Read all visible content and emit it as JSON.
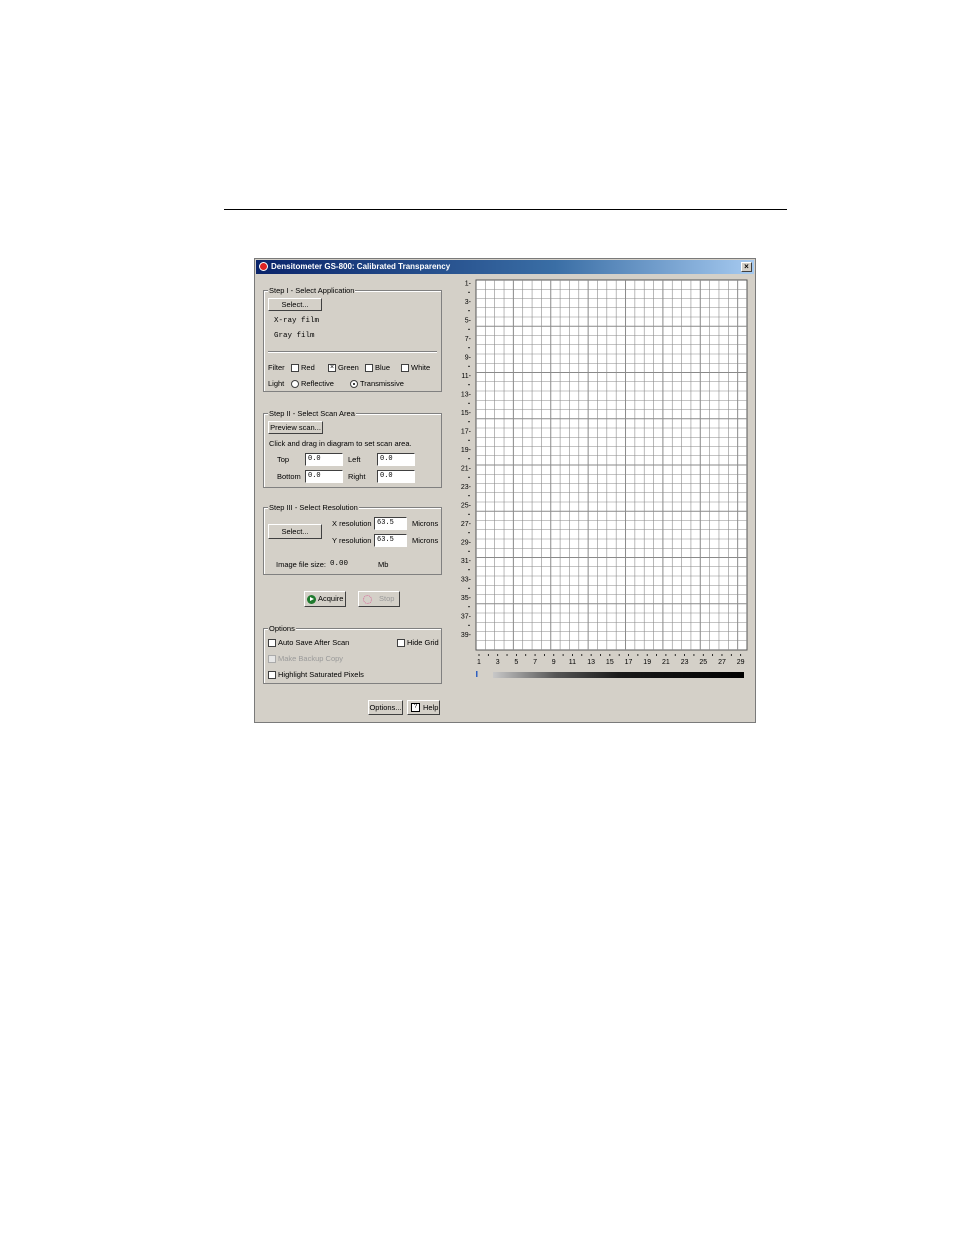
{
  "window": {
    "title": "Densitometer GS-800: Calibrated Transparency",
    "close_glyph": "×"
  },
  "step1": {
    "label": "Step I - Select Application",
    "select_button": "Select...",
    "applications": [
      "X-ray film",
      "Gray film"
    ],
    "filter_label": "Filter",
    "filters": [
      {
        "label": "Red",
        "checked": false
      },
      {
        "label": "Green",
        "checked": true
      },
      {
        "label": "Blue",
        "checked": false
      },
      {
        "label": "White",
        "checked": false
      }
    ],
    "light_label": "Light",
    "light_options": [
      {
        "label": "Reflective",
        "selected": false
      },
      {
        "label": "Transmissive",
        "selected": true
      }
    ]
  },
  "step2": {
    "label": "Step II - Select Scan Area",
    "preview_button": "Preview scan...",
    "instruction": "Click and drag in diagram to set scan area.",
    "top_label": "Top",
    "top_value": "0.0",
    "left_label": "Left",
    "left_value": "0.0",
    "bottom_label": "Bottom",
    "bottom_value": "0.0",
    "right_label": "Right",
    "right_value": "0.0"
  },
  "step3": {
    "label": "Step III - Select Resolution",
    "select_button": "Select...",
    "x_label": "X resolution",
    "x_value": "63.5",
    "x_unit": "Microns",
    "y_label": "Y resolution",
    "y_value": "63.5",
    "y_unit": "Microns",
    "filesize_label": "Image file size:",
    "filesize_value": "0.00",
    "filesize_unit": "Mb"
  },
  "actions": {
    "acquire": "Acquire",
    "stop": "Stop"
  },
  "options": {
    "label": "Options",
    "auto_save": "Auto Save After Scan",
    "hide_grid": "Hide Grid",
    "backup": "Make Backup Copy",
    "highlight": "Highlight Saturated Pixels"
  },
  "footer": {
    "options_button": "Options...",
    "help_button": "Help"
  },
  "grid": {
    "y_labels": [
      "1",
      "3",
      "5",
      "7",
      "9",
      "11",
      "13",
      "15",
      "17",
      "19",
      "21",
      "23",
      "25",
      "27",
      "29",
      "31",
      "33",
      "35",
      "37",
      "39"
    ],
    "x_labels": [
      "1",
      "3",
      "5",
      "7",
      "9",
      "11",
      "13",
      "15",
      "17",
      "19",
      "21",
      "23",
      "25",
      "27",
      "29"
    ]
  },
  "colors": {
    "titlebar_start": "#0a246a",
    "window_bg": "#d4d0c8",
    "grid_line": "#8a8a8a"
  }
}
